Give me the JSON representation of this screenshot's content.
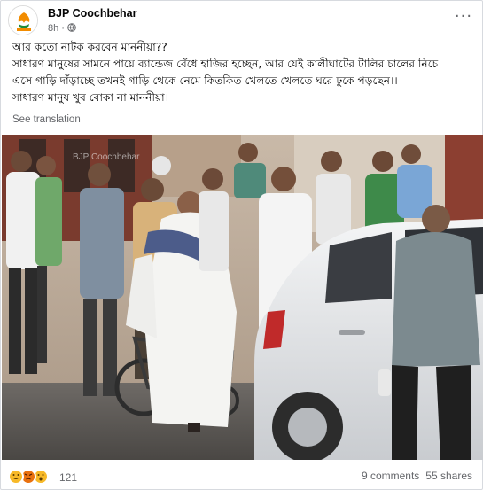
{
  "post": {
    "author": "BJP Coochbehar",
    "time": "8h",
    "body": [
      "আর কতো নাটক করবেন মাননীয়া??",
      "সাধারণ মানুষের সামনে পায়ে ব্যান্ডেজ বেঁধে হাজির হচ্ছেন, আর যেই কালীঘাটের টালির চালের নিচে",
      "এসে গাড়ি দাঁড়াচ্ছে তখনই গাড়ি থেকে নেমে কিতকিত খেলতে খেলতে ঘরে ঢুকে পড়ছেন।।",
      "সাধারণ মানুষ খুব বোকা না মাননীয়া।"
    ],
    "see_translation": "See translation",
    "photo_watermark": "BJP Coochbehar"
  },
  "footer": {
    "reaction_count": "121",
    "comments": "9 comments",
    "shares": "55 shares",
    "reactions": [
      "haha",
      "angry",
      "wow"
    ]
  },
  "colors": {
    "link_gray": "#65676b",
    "haha": "#f7b928",
    "angry": "#e9710f",
    "saffron": "#f28c00",
    "car_white": "#e9eaec"
  },
  "icons": [
    "globe-icon",
    "more-icon",
    "haha-icon",
    "angry-icon",
    "wow-icon"
  ]
}
